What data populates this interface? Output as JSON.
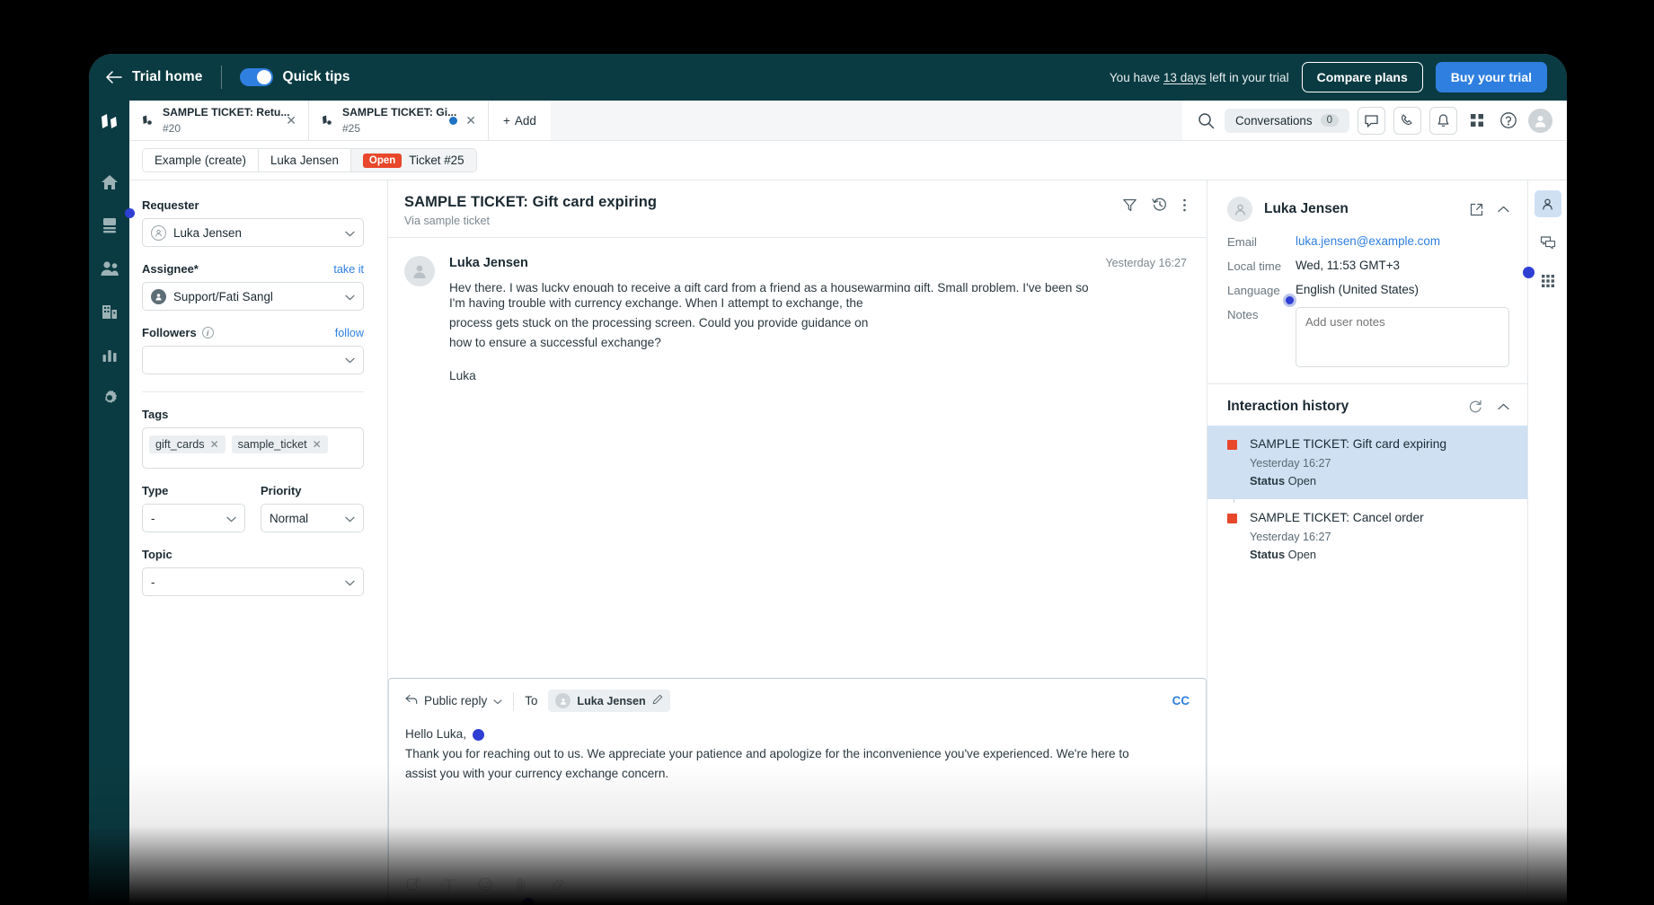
{
  "trialbar": {
    "back_icon": "arrow-left-icon",
    "home_label": "Trial home",
    "quick_tips_label": "Quick tips",
    "trial_text_pre": "You have ",
    "trial_days": "13 days",
    "trial_text_post": " left in your trial",
    "compare_plans_label": "Compare plans",
    "buy_trial_label": "Buy your trial",
    "accent_blue": "#2f7fe0",
    "bar_color": "#0b3b42"
  },
  "left_rail": {
    "items": [
      {
        "name": "logo-icon",
        "label": "Logo"
      },
      {
        "name": "home-icon",
        "label": "Home"
      },
      {
        "name": "tickets-icon",
        "label": "Tickets"
      },
      {
        "name": "contacts-icon",
        "label": "Contacts"
      },
      {
        "name": "organizations-icon",
        "label": "Organizations"
      },
      {
        "name": "reports-icon",
        "label": "Reports"
      },
      {
        "name": "settings-icon",
        "label": "Settings"
      }
    ]
  },
  "tabs": [
    {
      "title": "SAMPLE TICKET: Retu...",
      "number": "#20",
      "active": false,
      "has_dot": false
    },
    {
      "title": "SAMPLE TICKET: Gi...",
      "number": "#25",
      "active": true,
      "has_dot": true
    }
  ],
  "add_tab_label": "Add",
  "topbar": {
    "search_icon": "search-icon",
    "conversations_label": "Conversations",
    "conversations_count": "0",
    "chat_icon": "chat-icon",
    "phone_icon": "phone-icon",
    "bell_icon": "bell-icon",
    "apps_icon": "apps-grid-icon",
    "help_icon": "help-circle-icon",
    "avatar_icon": "user-avatar-icon"
  },
  "breadcrumb": {
    "items": [
      "Example (create)",
      "Luka Jensen"
    ],
    "status": "Open",
    "ticket": "Ticket #25"
  },
  "form": {
    "requester_label": "Requester",
    "requester_value": "Luka Jensen",
    "assignee_label": "Assignee*",
    "assignee_value": "Support/Fati Sangl",
    "take_it_label": "take it",
    "followers_label": "Followers",
    "follow_label": "follow",
    "followers_value": "",
    "tags_label": "Tags",
    "tags": [
      "gift_cards",
      "sample_ticket"
    ],
    "type_label": "Type",
    "type_value": "-",
    "priority_label": "Priority",
    "priority_value": "Normal",
    "topic_label": "Topic",
    "topic_value": "-"
  },
  "ticket": {
    "title": "SAMPLE TICKET: Gift card expiring",
    "subtitle": "Via sample ticket",
    "filter_icon": "filter-icon",
    "history_icon": "history-icon",
    "more_icon": "more-vertical-icon",
    "message": {
      "author": "Luka Jensen",
      "time": "Yesterday 16:27",
      "clipped_line": "Hey there. I was lucky enough to receive a gift card from a friend as a housewarming gift. Small problem. I've been so",
      "body_line_1": "I'm having trouble with currency exchange. When I attempt to exchange, the",
      "body_line_2": "process gets stuck on the processing screen. Could you provide guidance on",
      "body_line_3": "how to ensure a successful exchange?",
      "signature": "Luka"
    }
  },
  "composer": {
    "reply_mode": "Public reply",
    "to_label": "To",
    "to_recipient": "Luka Jensen",
    "edit_icon": "pencil-icon",
    "cc_label": "CC",
    "body_line_1": "Hello Luka,",
    "body_line_2": "Thank you for reaching out to us. We appreciate your patience and apologize for the inconvenience you've experienced. We're here to",
    "body_line_3": "assist you with your currency exchange concern.",
    "tools": [
      "signature-icon",
      "text-format-icon",
      "emoji-icon",
      "attachment-icon",
      "link-icon"
    ]
  },
  "customer": {
    "name": "Luka Jensen",
    "open_icon": "external-link-icon",
    "collapse_icon": "chevron-up-icon",
    "email_label": "Email",
    "email_value": "luka.jensen@example.com",
    "local_time_label": "Local time",
    "local_time_value": "Wed, 11:53 GMT+3",
    "language_label": "Language",
    "language_value": "English (United States)",
    "notes_label": "Notes",
    "notes_placeholder": "Add user notes",
    "notes_value": ""
  },
  "interaction_history": {
    "title": "Interaction history",
    "refresh_icon": "refresh-icon",
    "collapse_icon": "chevron-up-icon",
    "items": [
      {
        "title": "SAMPLE TICKET: Gift card expiring",
        "date": "Yesterday 16:27",
        "status_label": "Status",
        "status_value": "Open",
        "selected": true
      },
      {
        "title": "SAMPLE TICKET: Cancel order",
        "date": "Yesterday 16:27",
        "status_label": "Status",
        "status_value": "Open",
        "selected": false
      }
    ],
    "marker_color": "#e8472b"
  },
  "right_rail": {
    "items": [
      {
        "name": "user-profile-icon",
        "active": true
      },
      {
        "name": "conversations-icon",
        "active": false
      },
      {
        "name": "apps-grid-icon",
        "active": false
      }
    ]
  }
}
